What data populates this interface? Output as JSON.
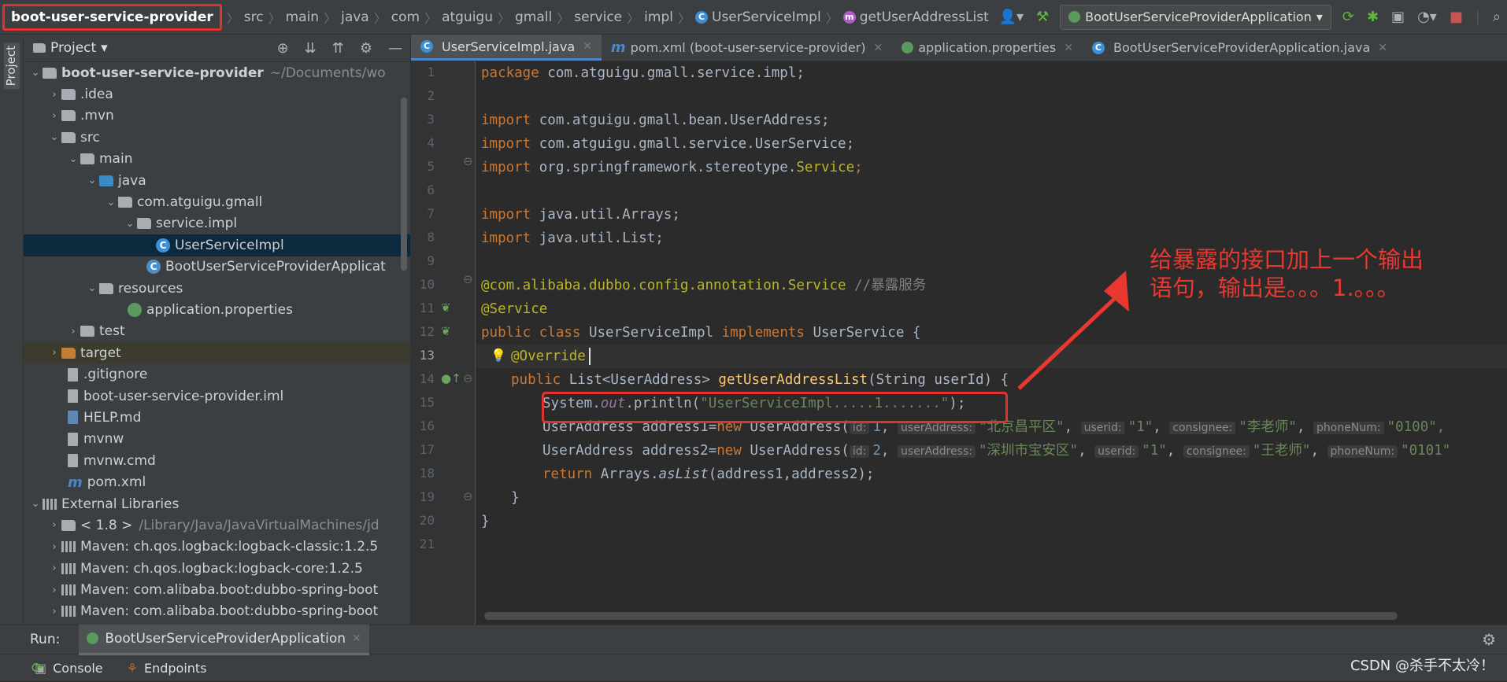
{
  "navbar": {
    "crumbs": [
      "boot-user-service-provider",
      "src",
      "main",
      "java",
      "com",
      "atguigu",
      "gmall",
      "service",
      "impl",
      "UserServiceImpl",
      "getUserAddressList"
    ],
    "run_config": "BootUserServiceProviderApplication"
  },
  "project_panel": {
    "title": "Project",
    "stripe_label": "Project",
    "tree": [
      {
        "label": "boot-user-service-provider",
        "extra": "~/Documents/wo"
      },
      {
        "label": ".idea"
      },
      {
        "label": ".mvn"
      },
      {
        "label": "src"
      },
      {
        "label": "main"
      },
      {
        "label": "java"
      },
      {
        "label": "com.atguigu.gmall"
      },
      {
        "label": "service.impl"
      },
      {
        "label": "UserServiceImpl"
      },
      {
        "label": "BootUserServiceProviderApplicat"
      },
      {
        "label": "resources"
      },
      {
        "label": "application.properties"
      },
      {
        "label": "test"
      },
      {
        "label": "target"
      },
      {
        "label": ".gitignore"
      },
      {
        "label": "boot-user-service-provider.iml"
      },
      {
        "label": "HELP.md"
      },
      {
        "label": "mvnw"
      },
      {
        "label": "mvnw.cmd"
      },
      {
        "label": "pom.xml"
      },
      {
        "label": "External Libraries"
      },
      {
        "label": "< 1.8 >",
        "extra": "/Library/Java/JavaVirtualMachines/jd"
      },
      {
        "label": "Maven: ch.qos.logback:logback-classic:1.2.5"
      },
      {
        "label": "Maven: ch.qos.logback:logback-core:1.2.5"
      },
      {
        "label": "Maven: com.alibaba.boot:dubbo-spring-boot"
      },
      {
        "label": "Maven: com.alibaba.boot:dubbo-spring-boot"
      }
    ]
  },
  "tabs": [
    {
      "label": "UserServiceImpl.java"
    },
    {
      "label": "pom.xml (boot-user-service-provider)"
    },
    {
      "label": "application.properties"
    },
    {
      "label": "BootUserServiceProviderApplication.java"
    }
  ],
  "editor": {
    "line_numbers": [
      "1",
      "2",
      "3",
      "4",
      "5",
      "6",
      "7",
      "8",
      "9",
      "10",
      "11",
      "12",
      "13",
      "14",
      "15",
      "16",
      "17",
      "18",
      "19",
      "20",
      "21"
    ],
    "code": {
      "l1_kw": "package",
      "l1_rest": " com.atguigu.gmall.service.impl;",
      "l3_kw": "import",
      "l3_rest": " com.atguigu.gmall.bean.UserAddress;",
      "l4_kw": "import",
      "l4_rest": " com.atguigu.gmall.service.UserService;",
      "l5_kw": "import",
      "l5_rest": " org.springframework.stereotype.",
      "l5_an": "Service",
      "l5_end": ";",
      "l7_kw": "import",
      "l7_rest": " java.util.Arrays;",
      "l8_kw": "import",
      "l8_rest": " java.util.List;",
      "l10_an": "@com.alibaba.dubbo.config.annotation.Service",
      "l10_cm": " //暴露服务",
      "l11_an": "@Service",
      "l12_kw1": "public class",
      "l12_cls": " UserServiceImpl ",
      "l12_kw2": "implements",
      "l12_rest": " UserService {",
      "l13_an": "@Override",
      "l14_kw": "public",
      "l14_a": " List<UserAddress> ",
      "l14_fn": "getUserAddressList",
      "l14_b": "(String userId) {",
      "l15_a": "System.",
      "l15_out": "out",
      "l15_b": ".println(",
      "l15_str": "\"UserServiceImpl.....1.......\"",
      "l15_end": ");",
      "l16_a": "UserAddress address1=",
      "l16_new": "new",
      "l16_b": " UserAddress(",
      "l16_h1": "id:",
      "l16_v1": "1",
      "l16_h2": "userAddress:",
      "l16_v2": "\"北京昌平区\"",
      "l16_h3": "userid:",
      "l16_v3": "\"1\"",
      "l16_h4": "consignee:",
      "l16_v4": "\"李老师\"",
      "l16_h5": "phoneNum:",
      "l16_v5": "\"0100\",",
      "l17_a": "UserAddress address2=",
      "l17_new": "new",
      "l17_b": " UserAddress(",
      "l17_h1": "id:",
      "l17_v1": "2",
      "l17_h2": "userAddress:",
      "l17_v2": "\"深圳市宝安区\"",
      "l17_h3": "userid:",
      "l17_v3": "\"1\"",
      "l17_h4": "consignee:",
      "l17_v4": "\"王老师\"",
      "l17_h5": "phoneNum:",
      "l17_v5": "\"0101\"",
      "l18_kw": "return",
      "l18_a": " Arrays.",
      "l18_it": "asList",
      "l18_b": "(address1,address2);",
      "l19": "}",
      "l20": "}"
    }
  },
  "annotation": {
    "line1": "给暴露的接口加上一个输出",
    "line2": "语句，输出是。。。1.。。。"
  },
  "run_panel": {
    "label": "Run:",
    "tab": "BootUserServiceProviderApplication",
    "console": "Console",
    "endpoints": "Endpoints"
  },
  "watermark": "CSDN @杀手不太冷！",
  "colors": {
    "accent_red": "#e0332f",
    "keyword": "#cc7832",
    "annotation": "#bbb529",
    "string": "#6a8759"
  }
}
